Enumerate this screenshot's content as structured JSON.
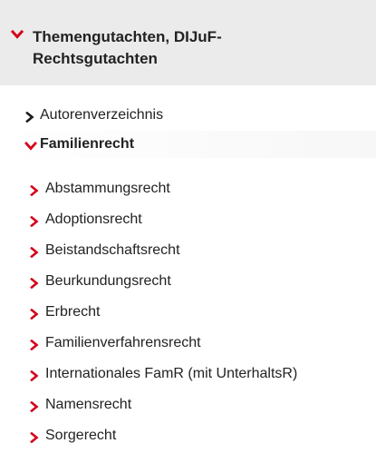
{
  "section": {
    "title": "Themengutachten, DIJuF-Rechtsgutachten",
    "title_line1": "Themengutachten, DIJuF-",
    "title_line2": "Rechtsgutachten",
    "expanded": true
  },
  "items": [
    {
      "label": "Autorenverzeichnis",
      "expanded": false,
      "level": 1
    },
    {
      "label": "Familienrecht",
      "expanded": true,
      "level": 1
    }
  ],
  "subitems": [
    {
      "label": "Abstammungsrecht"
    },
    {
      "label": "Adoptionsrecht"
    },
    {
      "label": "Beistandschaftsrecht"
    },
    {
      "label": "Beurkundungsrecht"
    },
    {
      "label": "Erbrecht"
    },
    {
      "label": "Familienverfahrensrecht"
    },
    {
      "label": "Internationales FamR (mit UnterhaltsR)"
    },
    {
      "label": "Namensrecht"
    },
    {
      "label": "Sorgerecht"
    }
  ],
  "colors": {
    "accent": "#d4001a",
    "dark_chevron": "#1a1a1a",
    "header_bg": "#ebebeb"
  }
}
